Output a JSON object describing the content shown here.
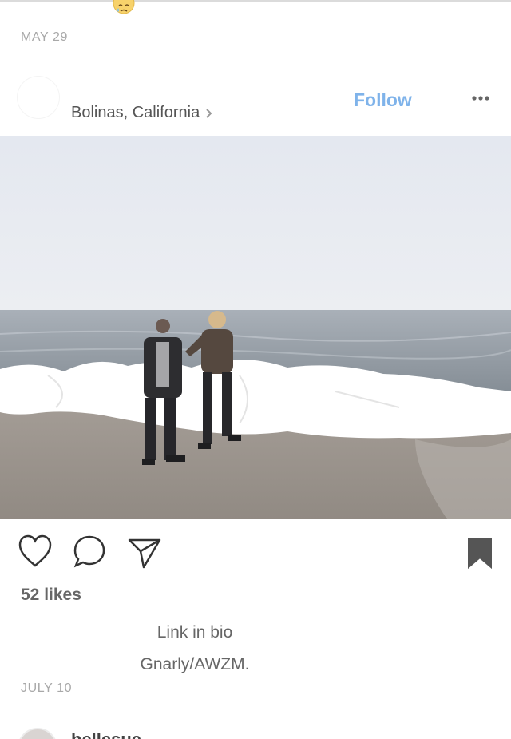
{
  "feed": {
    "previous_post": {
      "date": "MAY 29",
      "emoji_icon": "crying-face-icon"
    },
    "post": {
      "location": "Bolinas, California",
      "follow_label": "Follow",
      "more_icon": "ellipsis-icon",
      "photo": {
        "description_icon": "beach-photo",
        "colors": {
          "sky": "#e7e9ef",
          "sea": "#8b949c",
          "sand": "#9c958e"
        }
      },
      "actions": {
        "like_icon": "heart-icon",
        "comment_icon": "comment-bubble-icon",
        "share_icon": "paper-plane-icon",
        "save_icon": "bookmark-icon"
      },
      "likes_text": "52 likes",
      "caption_lines": [
        "Link in bio",
        "Gnarly/AWZM."
      ],
      "date": "JULY 10"
    },
    "next_post": {
      "username": "bellesue"
    }
  },
  "colors": {
    "follow": "#7fb3ea",
    "muted_text": "#a8a8a8",
    "body_text": "#666666"
  }
}
